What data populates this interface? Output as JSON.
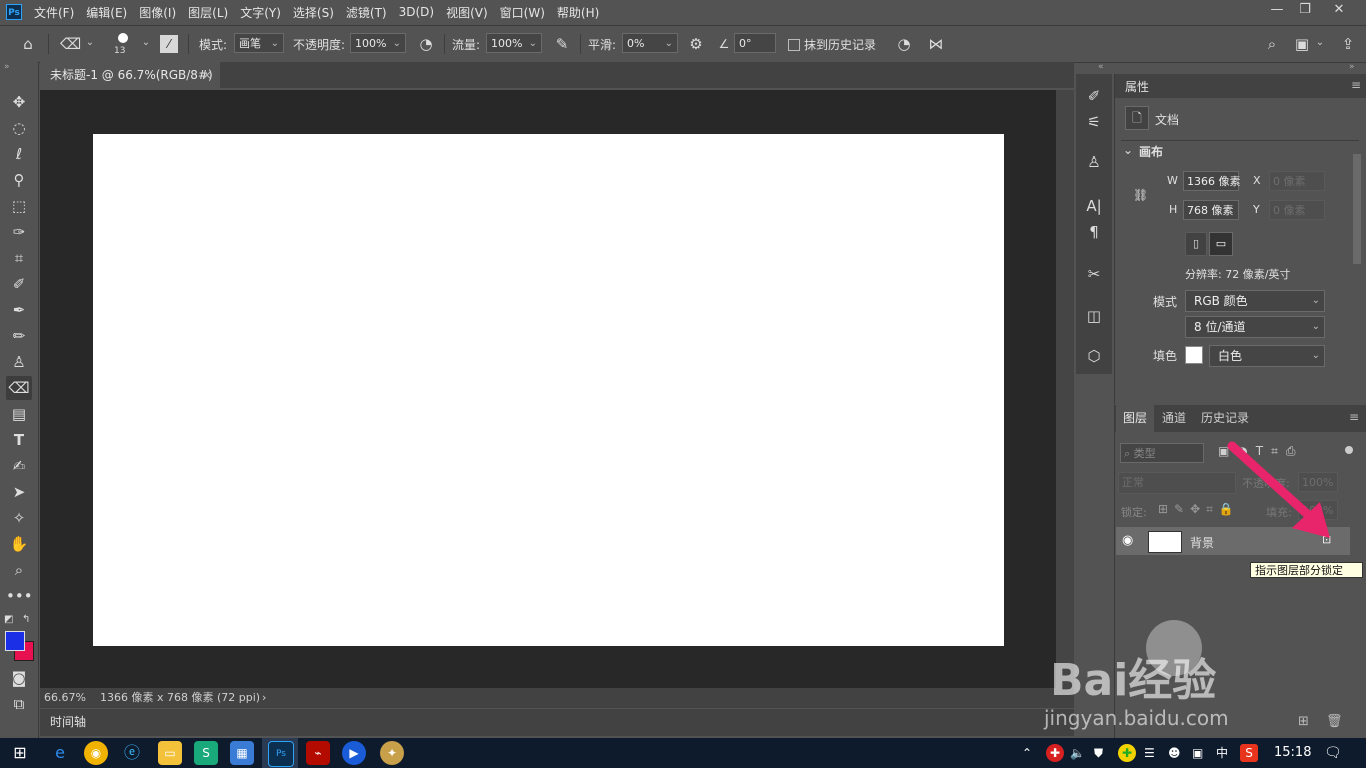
{
  "app": {
    "logo_text": "Ps"
  },
  "menu": [
    "文件(F)",
    "编辑(E)",
    "图像(I)",
    "图层(L)",
    "文字(Y)",
    "选择(S)",
    "滤镜(T)",
    "3D(D)",
    "视图(V)",
    "窗口(W)",
    "帮助(H)"
  ],
  "window_controls": {
    "minimize": "—",
    "restore": "❐",
    "close": "✕"
  },
  "options": {
    "brush_size": "13",
    "mode_label": "模式:",
    "mode_value": "画笔",
    "opacity_label": "不透明度:",
    "opacity_value": "100%",
    "flow_label": "流量:",
    "flow_value": "100%",
    "smooth_label": "平滑:",
    "smooth_value": "0%",
    "angle_value": "0°",
    "erase_history_label": "抹到历史记录"
  },
  "document": {
    "tab_title": "未标题-1 @ 66.7%(RGB/8#)",
    "tab_close": "×",
    "zoom": "66.67%",
    "info": "1366 像素 x 768 像素 (72 ppi)",
    "info_arrow": "›",
    "timeline_label": "时间轴",
    "canvas_color": "#ffffff"
  },
  "properties": {
    "title": "属性",
    "doc_label": "文档",
    "canvas_section": "画布",
    "w_label": "W",
    "w_value": "1366 像素",
    "h_label": "H",
    "h_value": "768 像素",
    "x_label": "X",
    "x_value": "0 像素",
    "y_label": "Y",
    "y_value": "0 像素",
    "resolution": "分辨率: 72 像素/英寸",
    "mode_label": "模式",
    "mode_value": "RGB 颜色",
    "depth_value": "8 位/通道",
    "fill_label": "填色",
    "fill_value": "白色"
  },
  "layers": {
    "tabs": [
      "图层",
      "通道",
      "历史记录"
    ],
    "filter_placeholder": "类型",
    "blend_mode": "正常",
    "opacity_label": "不透明度:",
    "opacity_value": "100%",
    "lock_label": "锁定:",
    "fill_label": "填充:",
    "fill_value": "100%",
    "layer_name": "背景",
    "tooltip": "指示图层部分锁定"
  },
  "watermark": {
    "text": "Bai经验",
    "url": "jingyan.baidu.com"
  },
  "taskbar": {
    "ime": "中",
    "time": "15:18"
  },
  "colors": {
    "foreground": "#1a2fe6",
    "background": "#e8114f",
    "accent_arrow": "#e8246a"
  }
}
